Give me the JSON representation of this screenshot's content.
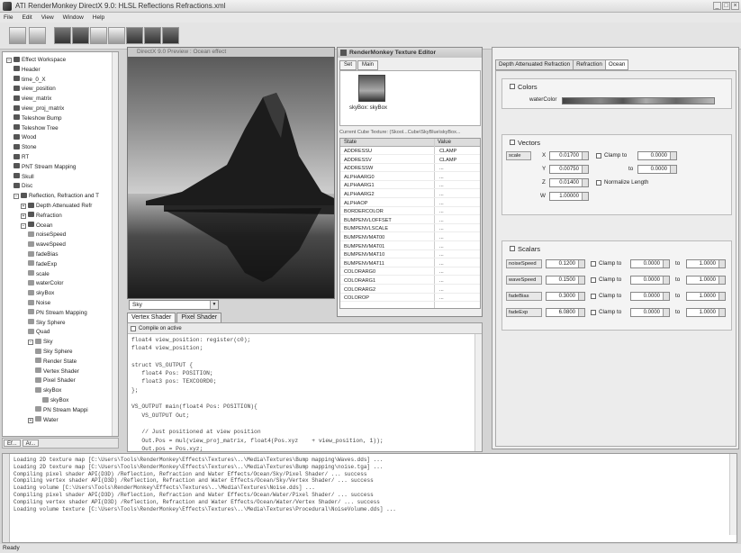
{
  "window": {
    "title": "ATI RenderMonkey DirectX 9.0: HLSL Reflections Refractions.xml"
  },
  "menu": [
    "File",
    "Edit",
    "View",
    "Window",
    "Help"
  ],
  "tree": {
    "items": [
      {
        "label": "Effect Workspace",
        "depth": 0,
        "expander": "−"
      },
      {
        "label": "Header",
        "depth": 1
      },
      {
        "label": "time_0_X",
        "depth": 1
      },
      {
        "label": "view_position",
        "depth": 1
      },
      {
        "label": "view_matrix",
        "depth": 1
      },
      {
        "label": "view_proj_matrix",
        "depth": 1
      },
      {
        "label": "Teleshow Bump",
        "depth": 1
      },
      {
        "label": "Teleshow Tree",
        "depth": 1
      },
      {
        "label": "Wood",
        "depth": 1
      },
      {
        "label": "Stone",
        "depth": 1
      },
      {
        "label": "RT",
        "depth": 1
      },
      {
        "label": "PNT Stream Mapping",
        "depth": 1
      },
      {
        "label": "Skull",
        "depth": 1
      },
      {
        "label": "Disc",
        "depth": 1
      },
      {
        "label": "Reflection, Refraction and T",
        "depth": 1,
        "expander": "−"
      },
      {
        "label": "Depth Attenuated Refr",
        "depth": 2,
        "expander": "+"
      },
      {
        "label": "Refraction",
        "depth": 2,
        "expander": "+"
      },
      {
        "label": "Ocean",
        "depth": 2,
        "expander": "−"
      },
      {
        "label": "noiseSpeed",
        "depth": 3
      },
      {
        "label": "waveSpeed",
        "depth": 3
      },
      {
        "label": "fadeBias",
        "depth": 3
      },
      {
        "label": "fadeExp",
        "depth": 3
      },
      {
        "label": "scale",
        "depth": 3
      },
      {
        "label": "waterColor",
        "depth": 3
      },
      {
        "label": "skyBox",
        "depth": 3
      },
      {
        "label": "Noise",
        "depth": 3
      },
      {
        "label": "PN Stream Mapping",
        "depth": 3
      },
      {
        "label": "Sky Sphere",
        "depth": 3
      },
      {
        "label": "Quad",
        "depth": 3
      },
      {
        "label": "Sky",
        "depth": 3,
        "expander": "−"
      },
      {
        "label": "Sky Sphere",
        "depth": 4
      },
      {
        "label": "Render State",
        "depth": 4
      },
      {
        "label": "Vertex Shader",
        "depth": 4
      },
      {
        "label": "Pixel Shader",
        "depth": 4
      },
      {
        "label": "skyBox",
        "depth": 4
      },
      {
        "label": "skyBox",
        "depth": 5
      },
      {
        "label": "PN Stream Mappi",
        "depth": 4
      },
      {
        "label": "Water",
        "depth": 3,
        "expander": "+"
      }
    ],
    "bottom_tabs": [
      "Ef...",
      "Ar..."
    ]
  },
  "preview": {
    "title": "DirectX 9.0 Preview : Ocean effect"
  },
  "pass_select": {
    "value": "Sky"
  },
  "shader_tabs": [
    "Vertex Shader",
    "Pixel Shader"
  ],
  "code": {
    "toolbar_label": "Compile on active",
    "lines": [
      "float4 view_position: register(c0);",
      "float4 view_position;",
      "",
      "struct VS_OUTPUT {",
      "   float4 Pos: POSITION;",
      "   float3 pos: TEXCOORD0;",
      "};",
      "",
      "VS_OUTPUT main(float4 Pos: POSITION){",
      "   VS_OUTPUT Out;",
      "",
      "   // Just positioned at view position",
      "   Out.Pos = mul(view_proj_matrix, float4(Pos.xyz    + view_position, 1));",
      "   Out.pos = Pos.xyz;"
    ]
  },
  "texture_editor": {
    "title": "RenderMonkey Texture Editor",
    "tabs": [
      "Set",
      "Main"
    ],
    "thumb_label": "skyBox: skyBox",
    "path": "Current Cube Texture: (Skool...Cube\\SkyBlue\\skyBox...",
    "col_state": "State",
    "col_value": "Value",
    "rows": [
      {
        "state": "ADDRESSU",
        "value": "CLAMP"
      },
      {
        "state": "ADDRESSV",
        "value": "CLAMP"
      },
      {
        "state": "ADDRESSW",
        "value": "..."
      },
      {
        "state": "ALPHAARG0",
        "value": "..."
      },
      {
        "state": "ALPHAARG1",
        "value": "..."
      },
      {
        "state": "ALPHAARG2",
        "value": "..."
      },
      {
        "state": "ALPHAOP",
        "value": "..."
      },
      {
        "state": "BORDERCOLOR",
        "value": "..."
      },
      {
        "state": "BUMPENVLOFFSET",
        "value": "..."
      },
      {
        "state": "BUMPENVLSCALE",
        "value": "..."
      },
      {
        "state": "BUMPENVMAT00",
        "value": "..."
      },
      {
        "state": "BUMPENVMAT01",
        "value": "..."
      },
      {
        "state": "BUMPENVMAT10",
        "value": "..."
      },
      {
        "state": "BUMPENVMAT11",
        "value": "..."
      },
      {
        "state": "COLORARG0",
        "value": "..."
      },
      {
        "state": "COLORARG1",
        "value": "..."
      },
      {
        "state": "COLORARG2",
        "value": "..."
      },
      {
        "state": "COLOROP",
        "value": "..."
      }
    ]
  },
  "right_panel": {
    "tabs": [
      "Depth Attenuated Refraction",
      "Refraction",
      "Ocean"
    ],
    "colors": {
      "title": "Colors",
      "label": "waterColor"
    },
    "vectors": {
      "title": "Vectors",
      "name": "scale",
      "x": "0.01700",
      "y": "0.00750",
      "z": "0.01400",
      "w": "1.00000",
      "clamp_label": "Clamp to",
      "clamp_val": "0.0000",
      "to_label": "to",
      "to_val": "0.0000",
      "normalize_label": "Normalize Length"
    },
    "scalars": {
      "title": "Scalars",
      "rows": [
        {
          "name": "noiseSpeed",
          "value": "0.1200",
          "clamp": "Clamp to",
          "min": "0.0000",
          "to": "to",
          "max": "1.0000"
        },
        {
          "name": "waveSpeed",
          "value": "0.1500",
          "clamp": "Clamp to",
          "min": "0.0000",
          "to": "to",
          "max": "1.0000"
        },
        {
          "name": "fadeBias",
          "value": "0.3000",
          "clamp": "Clamp to",
          "min": "0.0000",
          "to": "to",
          "max": "1.0000"
        },
        {
          "name": "fadeExp",
          "value": "6.0800",
          "clamp": "Clamp to",
          "min": "0.0000",
          "to": "to",
          "max": "1.0000"
        }
      ]
    }
  },
  "output": {
    "lines": [
      "Loading 2D texture map [C:\\Users\\Tools\\RenderMonkey\\Effects\\Textures\\..\\Media\\Textures\\Bump mapping\\Waves.dds] ...",
      "Loading 2D texture map [C:\\Users\\Tools\\RenderMonkey\\Effects\\Textures\\..\\Media\\Textures\\Bump mapping\\noise.tga] ...",
      "Compiling pixel shader API(D3D) /Reflection, Refraction and Water Effects/Ocean/Sky/Pixel Shader/ ... success",
      "Compiling vertex shader API(D3D) /Reflection, Refraction and Water Effects/Ocean/Sky/Vertex Shader/ ... success",
      "Loading volume [C:\\Users\\Tools\\RenderMonkey\\Effects\\Textures\\..\\Media\\Textures\\Noise.dds] ...",
      "Compiling pixel shader API(D3D) /Reflection, Refraction and Water Effects/Ocean/Water/Pixel Shader/ ... success",
      "Compiling vertex shader API(D3D) /Reflection, Refraction and Water Effects/Ocean/Water/Vertex Shader/ ... success",
      "Loading volume texture [C:\\Users\\Tools\\RenderMonkey\\Effects\\Textures\\..\\Media\\Textures\\Procedural\\NoiseVolume.dds] ..."
    ]
  },
  "status": {
    "text": "Ready"
  }
}
